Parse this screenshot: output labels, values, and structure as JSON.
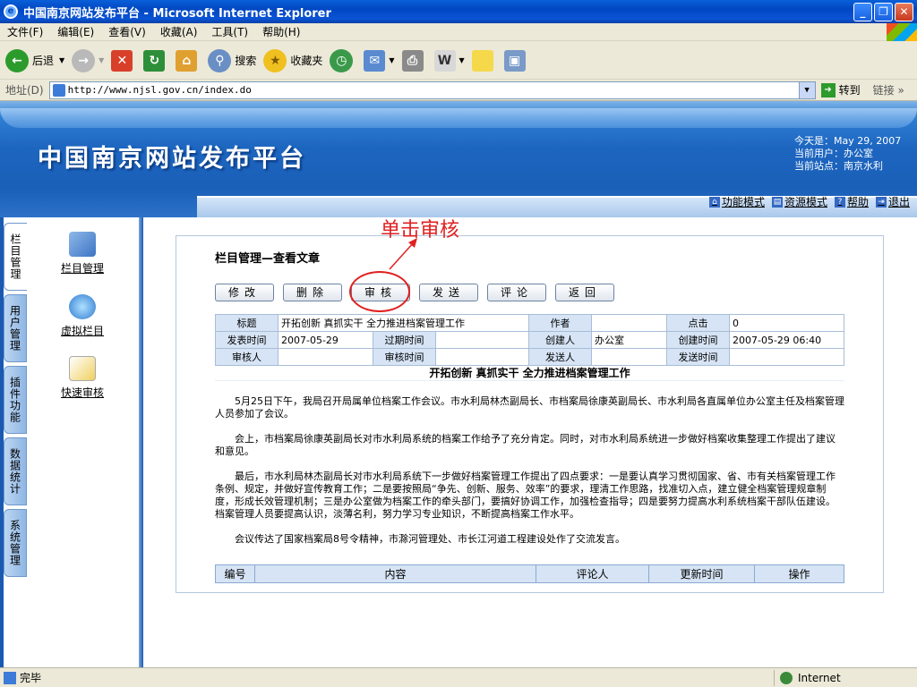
{
  "window": {
    "title": "中国南京网站发布平台 - Microsoft Internet Explorer"
  },
  "menu": [
    "文件(F)",
    "编辑(E)",
    "查看(V)",
    "收藏(A)",
    "工具(T)",
    "帮助(H)"
  ],
  "toolbar": {
    "back": "后退",
    "search": "搜索",
    "favorites": "收藏夹"
  },
  "address": {
    "label": "地址(D)",
    "url": "http://www.njsl.gov.cn/index.do",
    "go": "转到",
    "links": "链接"
  },
  "banner": {
    "site_title": "中国南京网站发布平台",
    "today": "今天是：May 29, 2007",
    "current_user": "当前用户：办公室",
    "current_site": "当前站点：南京水利"
  },
  "nav": {
    "func_mode": "功能模式",
    "res_mode": "资源模式",
    "help": "帮助",
    "logout": "退出"
  },
  "sidetabs": [
    "栏目管理",
    "用户管理",
    "插件功能",
    "数据统计",
    "系统管理"
  ],
  "shortcuts": [
    "栏目管理",
    "虚拟栏目",
    "快速审核"
  ],
  "page": {
    "title": "栏目管理—查看文章"
  },
  "buttons": [
    "修改",
    "删除",
    "审核",
    "发送",
    "评论",
    "返回"
  ],
  "annotation": "单击审核",
  "meta": {
    "title_label": "标题",
    "title_value": "开拓创新 真抓实干 全力推进档案管理工作",
    "author_label": "作者",
    "author_value": "",
    "clicks_label": "点击",
    "clicks_value": "0",
    "pub_time_label": "发表时间",
    "pub_time_value": "2007-05-29",
    "expire_label": "过期时间",
    "expire_value": "",
    "creator_label": "创建人",
    "creator_value": "办公室",
    "create_time_label": "创建时间",
    "create_time_value": "2007-05-29 06:40",
    "reviewer_label": "审核人",
    "reviewer_value": "",
    "review_time_label": "审核时间",
    "review_time_value": "",
    "sender_label": "发送人",
    "sender_value": "",
    "send_time_label": "发送时间",
    "send_time_value": ""
  },
  "article": {
    "heading": "开拓创新 真抓实干 全力推进档案管理工作",
    "paragraphs": [
      "5月25日下午，我局召开局属单位档案工作会议。市水利局林杰副局长、市档案局徐康英副局长、市水利局各直属单位办公室主任及档案管理人员参加了会议。",
      "会上，市档案局徐康英副局长对市水利局系统的档案工作给予了充分肯定。同时，对市水利局系统进一步做好档案收集整理工作提出了建议和意见。",
      "最后，市水利局林杰副局长对市水利局系统下一步做好档案管理工作提出了四点要求：一是要认真学习贯彻国家、省、市有关档案管理工作条例、规定，并做好宣传教育工作；二是要按照局“争先、创新、服务、效率”的要求，理清工作思路，找准切入点，建立健全档案管理规章制度，形成长效管理机制；三是办公室做为档案工作的牵头部门，要搞好协调工作，加强检查指导；四是要努力提高水利系统档案干部队伍建设。档案管理人员要提高认识，淡薄名利，努力学习专业知识，不断提高档案工作水平。",
      "会议传达了国家档案局8号令精神，市滁河管理处、市长江河道工程建设处作了交流发言。"
    ]
  },
  "comments": {
    "headers": [
      "编号",
      "内容",
      "评论人",
      "更新时间",
      "操作"
    ]
  },
  "status": {
    "text": "完毕",
    "zone": "Internet"
  }
}
